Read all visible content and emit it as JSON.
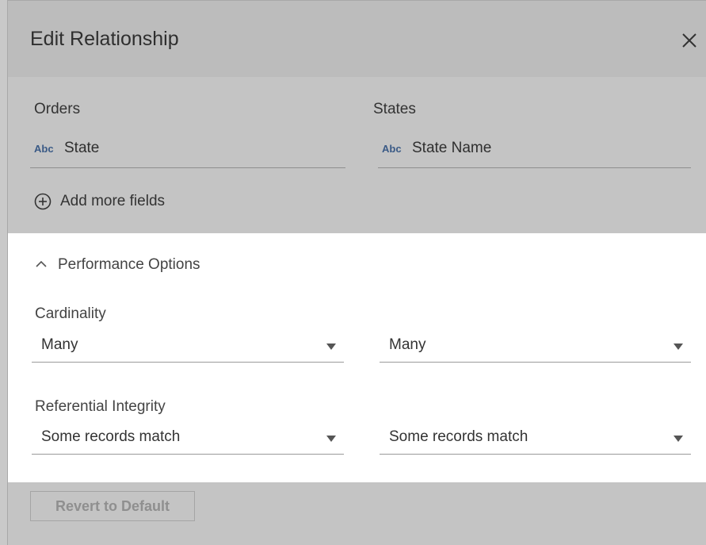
{
  "dialog": {
    "title": "Edit Relationship",
    "close_icon": "close-icon"
  },
  "relationship": {
    "left": {
      "table": "Orders",
      "field_type": "Abc",
      "field": "State"
    },
    "right": {
      "table": "States",
      "field_type": "Abc",
      "field": "State Name"
    },
    "add_more_label": "Add more fields"
  },
  "performance": {
    "toggle_label": "Performance Options",
    "expanded": true,
    "cardinality": {
      "label": "Cardinality",
      "left_value": "Many",
      "right_value": "Many"
    },
    "referential_integrity": {
      "label": "Referential Integrity",
      "left_value": "Some records match",
      "right_value": "Some records match"
    }
  },
  "footer": {
    "revert_label": "Revert to Default",
    "revert_enabled": false
  },
  "colors": {
    "dialog_bg": "#c4c4c4",
    "panel_bg": "#ffffff",
    "type_badge": "#3a5a86",
    "disabled_text": "#8f8f8f"
  }
}
